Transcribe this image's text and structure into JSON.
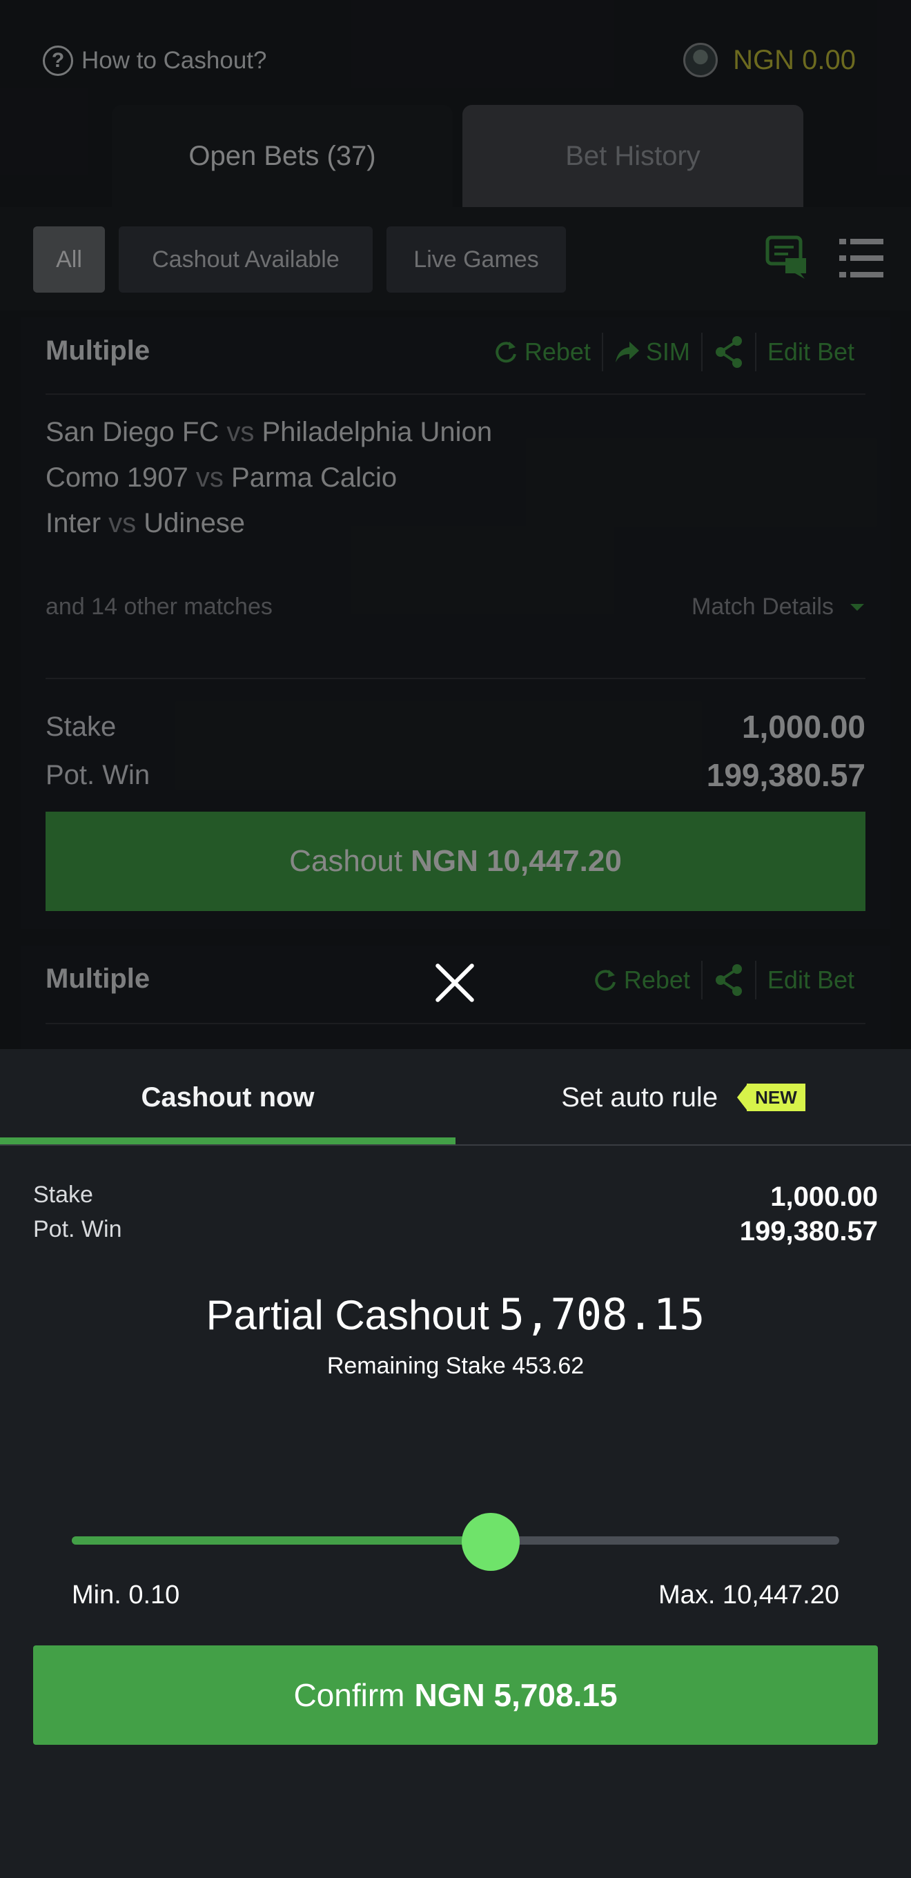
{
  "header": {
    "help_label": "How to Cashout?",
    "balance": "NGN 0.00"
  },
  "tabs": {
    "open_bets": "Open Bets (37)",
    "bet_history": "Bet History"
  },
  "filters": [
    {
      "label": "All",
      "active": true
    },
    {
      "label": "Cashout Available",
      "active": false
    },
    {
      "label": "Live Games",
      "active": false
    }
  ],
  "icons": {
    "chat": "chat-icon",
    "list": "list-icon"
  },
  "bet_card_1": {
    "title": "Multiple",
    "actions": {
      "rebet": "Rebet",
      "sim": "SIM",
      "edit": "Edit Bet"
    },
    "matches": [
      {
        "home": "San Diego FC",
        "vs": "vs",
        "away": "Philadelphia Union"
      },
      {
        "home": "Como 1907",
        "vs": "vs",
        "away": "Parma Calcio"
      },
      {
        "home": "Inter",
        "vs": "vs",
        "away": "Udinese"
      }
    ],
    "other_matches": "and 14 other matches",
    "match_details": "Match Details",
    "stake_label": "Stake",
    "stake_value": "1,000.00",
    "potwin_label": "Pot. Win",
    "potwin_value": "199,380.57",
    "cashout_label": "Cashout",
    "cashout_amount": "NGN 10,447.20"
  },
  "bet_card_2": {
    "title": "Multiple",
    "actions": {
      "rebet": "Rebet",
      "edit": "Edit Bet"
    }
  },
  "sheet": {
    "tab_cashout_now": "Cashout now",
    "tab_auto_rule": "Set auto rule",
    "new_badge": "NEW",
    "stake_label": "Stake",
    "stake_value": "1,000.00",
    "potwin_label": "Pot. Win",
    "potwin_value": "199,380.57",
    "partial_label": "Partial Cashout",
    "partial_amount": "5,708.15",
    "remaining": "Remaining Stake 453.62",
    "slider": {
      "min_label": "Min. 0.10",
      "max_label": "Max. 10,447.20",
      "fraction": 0.546
    },
    "confirm_label": "Confirm",
    "confirm_amount": "NGN 5,708.15"
  },
  "colors": {
    "accent_green": "#43a047",
    "balance_yellow": "#c5c13a",
    "badge_yellow": "#d7f34a",
    "thumb_green": "#6fe36a"
  }
}
